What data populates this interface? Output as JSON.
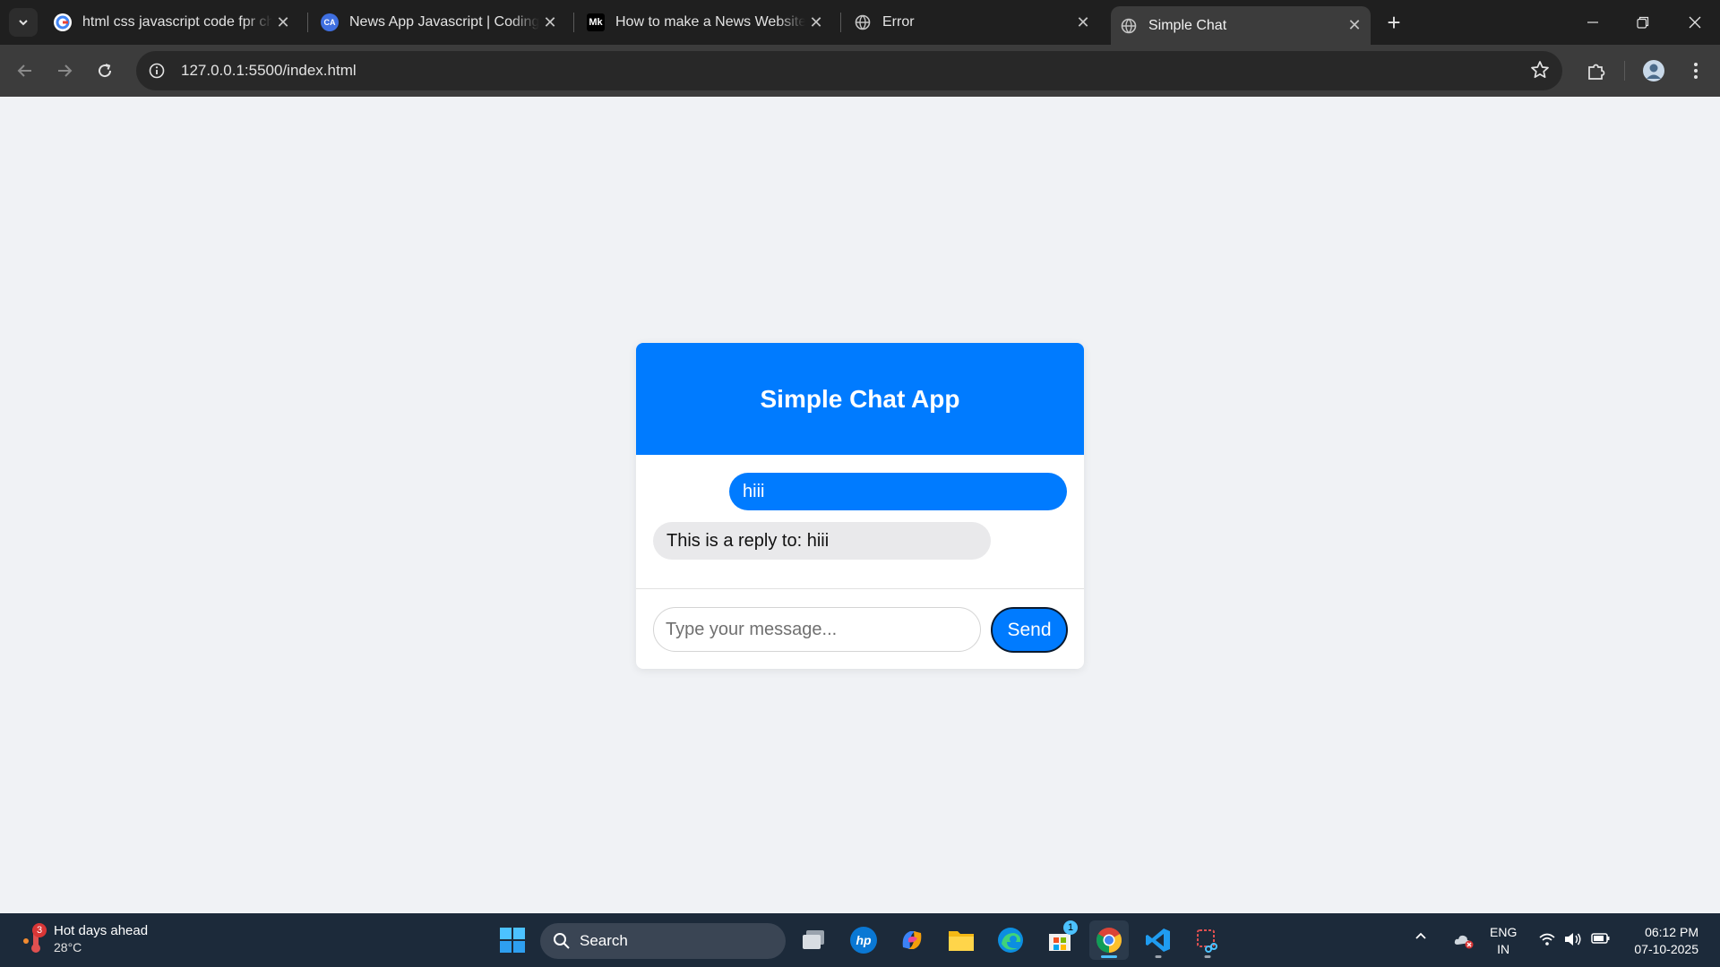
{
  "browser": {
    "tabs": [
      {
        "title": "html css javascript code fpr chat",
        "favicon": "google-icon"
      },
      {
        "title": "News App Javascript | Coding Artist",
        "favicon": "coding-artist-icon"
      },
      {
        "title": "How to make a News Website with",
        "favicon": "medium-icon"
      },
      {
        "title": "Error",
        "favicon": "globe-icon"
      },
      {
        "title": "Simple Chat",
        "favicon": "globe-icon"
      }
    ],
    "medium_logo": "Mk",
    "url": "127.0.0.1:5500/index.html"
  },
  "chat": {
    "title": "Simple Chat App",
    "messages": [
      {
        "sender": "user",
        "text": "hiii"
      },
      {
        "sender": "bot",
        "text": "This is a reply to: hiii"
      }
    ],
    "input_placeholder": "Type your message...",
    "send_label": "Send"
  },
  "taskbar": {
    "weather_title": "Hot days ahead",
    "weather_temp": "28°C",
    "weather_badge": "3",
    "search_label": "Search",
    "store_badge": "1",
    "lang_line1": "ENG",
    "lang_line2": "IN",
    "time": "06:12 PM",
    "date": "07-10-2025"
  },
  "colors": {
    "accent": "#007bff",
    "page_bg": "#f0f2f5",
    "bot_bubble": "#e9e9eb",
    "chrome_dark": "#1f1f1f",
    "toolbar": "#3c3c3c",
    "taskbar": "#1c2a3a"
  }
}
